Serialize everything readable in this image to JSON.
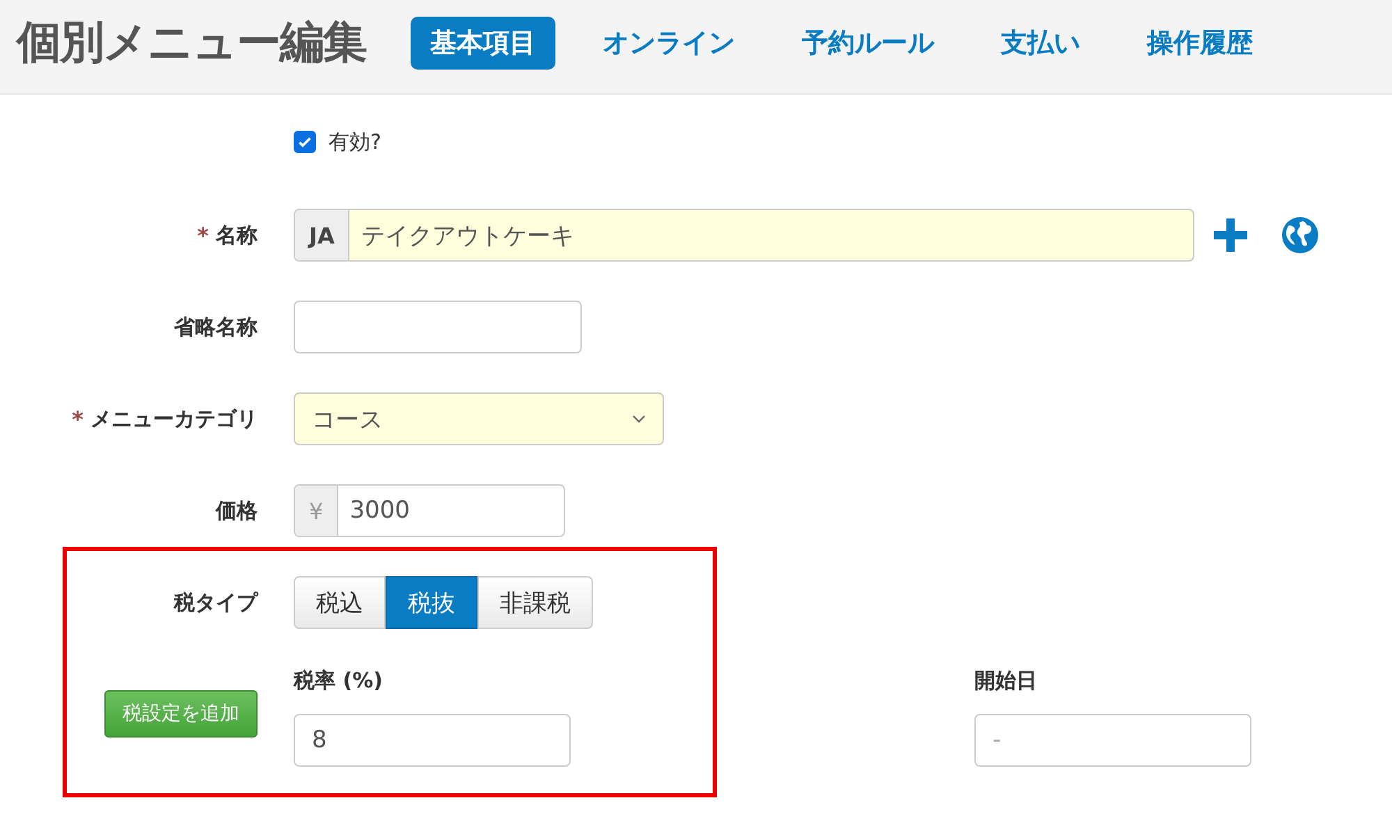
{
  "header": {
    "title": "個別メニュー編集",
    "tabs": [
      {
        "label": "基本項目",
        "selected": true
      },
      {
        "label": "オンライン",
        "selected": false
      },
      {
        "label": "予約ルール",
        "selected": false
      },
      {
        "label": "支払い",
        "selected": false
      },
      {
        "label": "操作履歴",
        "selected": false
      }
    ]
  },
  "enabled": {
    "label": "有効?",
    "checked": true
  },
  "fields": [
    {
      "kind": "lang-text",
      "label": "名称",
      "required": true,
      "prefix": "JA",
      "value": "テイクアウトケーキ"
    },
    {
      "kind": "text",
      "label": "省略名称",
      "required": false
    },
    {
      "kind": "select",
      "label": "メニューカテゴリ",
      "required": true,
      "value": "コース"
    },
    {
      "kind": "price",
      "label": "価格",
      "required": false,
      "prefix": "¥",
      "value": "3000"
    }
  ],
  "tax_type": {
    "label": "税タイプ",
    "options": [
      {
        "label": "税込",
        "selected": false
      },
      {
        "label": "税抜",
        "selected": true
      },
      {
        "label": "非課税",
        "selected": false
      }
    ]
  },
  "tax_setting": {
    "add_button": "税設定を追加",
    "rate_label": "税率 (%)",
    "rate_value": "8",
    "start_label": "開始日",
    "start_placeholder": "-"
  },
  "annotation": {
    "kind": "highlight-box"
  },
  "required_mark": "*"
}
